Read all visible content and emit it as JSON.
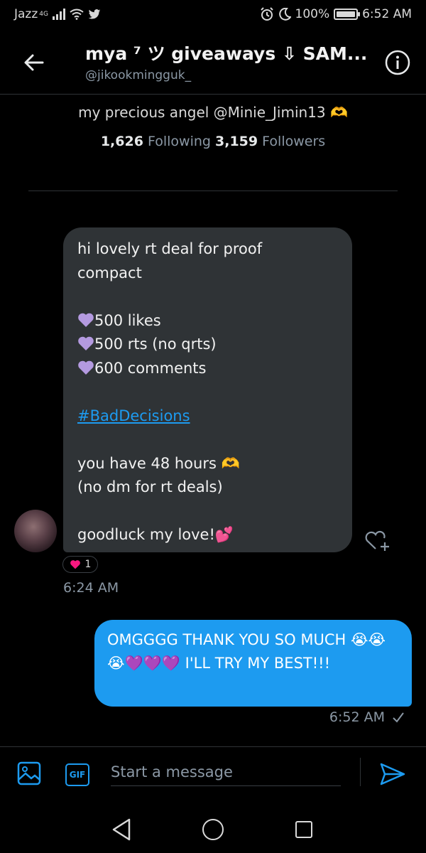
{
  "status_bar": {
    "carrier": "Jazz",
    "network": "4G",
    "battery": "100%",
    "time": "6:52 AM"
  },
  "header": {
    "title": "mya ⁷ ツ giveaways ⇩ SAM...",
    "handle": "@jikookmingguk_"
  },
  "profile": {
    "bio": "my precious angel @Minie_Jimin13 🫶",
    "following_count": "1,626",
    "following_label": "Following",
    "followers_count": "3,159",
    "followers_label": "Followers"
  },
  "received_message": {
    "line1": "hi lovely rt deal for proof",
    "line2": "compact",
    "item1": "500 likes",
    "item2": "500 rts (no qrts)",
    "item3": "600 comments",
    "hashtag": "#BadDecisions",
    "line3": "you have 48 hours 🫶",
    "line4": "(no dm for rt deals)",
    "line5": "goodluck my love!💕",
    "reaction_count": "1",
    "time": "6:24 AM"
  },
  "sent_message": {
    "text": "OMGGGG THANK YOU SO MUCH 😭😭😭💜💜💜 I'LL TRY MY BEST!!!",
    "time": "6:52 AM"
  },
  "composer": {
    "gif_label": "GIF",
    "placeholder": "Start a message"
  },
  "colors": {
    "accent": "#1d9bf0",
    "bubble_received": "#2f3336",
    "background": "#000000",
    "heart_purple": "#b49ae0"
  }
}
